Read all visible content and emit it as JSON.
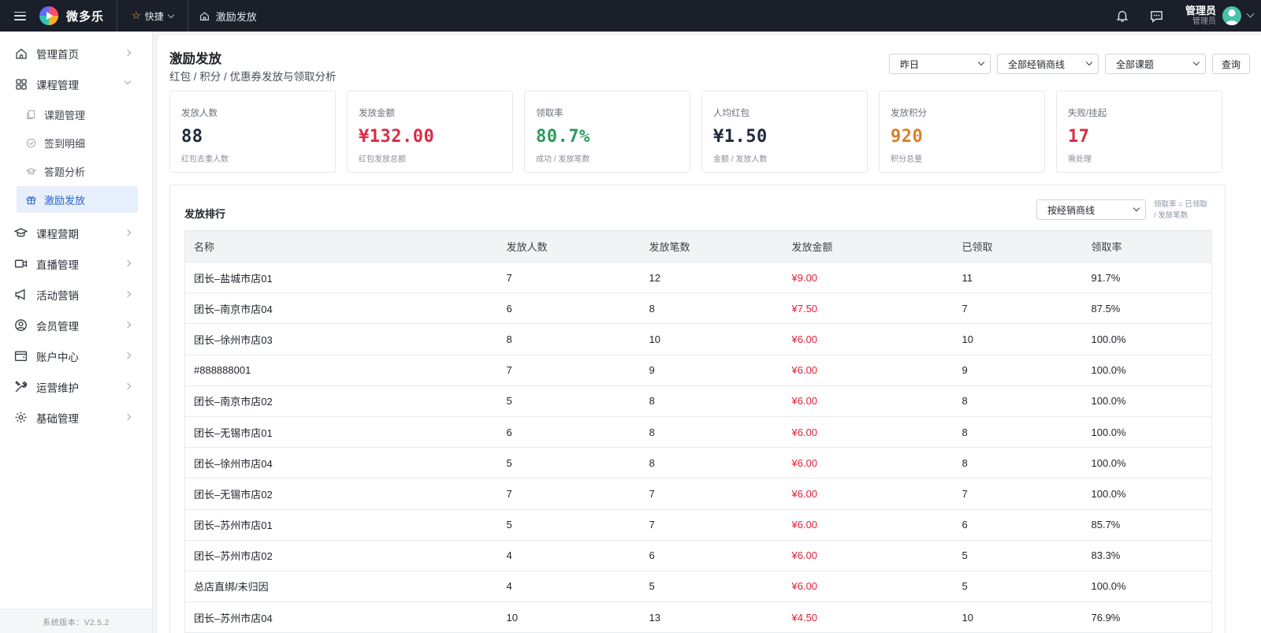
{
  "topbar": {
    "brand": "微多乐",
    "quick_label": "快捷",
    "breadcrumb": "激励发放",
    "user_name": "管理员",
    "user_role": "管理员"
  },
  "sidebar": {
    "items": [
      {
        "label": "管理首页",
        "icon": "home-icon"
      },
      {
        "label": "课程管理",
        "icon": "grid-icon",
        "expanded": true
      },
      {
        "label": "课程营期",
        "icon": "graduation-cap-icon"
      },
      {
        "label": "直播管理",
        "icon": "video-camera-icon"
      },
      {
        "label": "活动营销",
        "icon": "megaphone-icon"
      },
      {
        "label": "会员管理",
        "icon": "user-circle-icon"
      },
      {
        "label": "账户中心",
        "icon": "wallet-icon"
      },
      {
        "label": "运营维护",
        "icon": "tools-icon"
      },
      {
        "label": "基础管理",
        "icon": "gear-icon"
      }
    ],
    "subitems": [
      {
        "label": "课题管理",
        "icon": "document-copy-icon"
      },
      {
        "label": "签到明细",
        "icon": "check-circle-icon"
      },
      {
        "label": "答题分析",
        "icon": "cap-icon"
      },
      {
        "label": "激励发放",
        "icon": "gift-icon",
        "active": true
      }
    ],
    "version": "系统版本：V2.5.2"
  },
  "page": {
    "title": "激励发放",
    "subtitle": "红包 / 积分 / 优惠券发放与领取分析"
  },
  "filters": {
    "date": "昨日",
    "dealer": "全部经销商线",
    "topic": "全部课题",
    "query_label": "查询"
  },
  "stats": [
    {
      "label": "发放人数",
      "value": "88",
      "desc": "红包去重人数",
      "color": "#1f2a3c"
    },
    {
      "label": "发放金额",
      "value": "¥132.00",
      "desc": "红包发放总额",
      "color": "#d92d46"
    },
    {
      "label": "领取率",
      "value": "80.7%",
      "desc": "成功 / 发放笔数",
      "color": "#2f9a5c"
    },
    {
      "label": "人均红包",
      "value": "¥1.50",
      "desc": "金额 / 发放人数",
      "color": "#1f2a3c"
    },
    {
      "label": "发放积分",
      "value": "920",
      "desc": "积分总量",
      "color": "#d9802a"
    },
    {
      "label": "失败/挂起",
      "value": "17",
      "desc": "需处理",
      "color": "#d92d46"
    }
  ],
  "ranking": {
    "title": "发放排行",
    "group_by": "按经销商线",
    "note": "领取率 = 已领取 / 发放笔数",
    "columns": [
      "名称",
      "发放人数",
      "发放笔数",
      "发放金额",
      "已领取",
      "领取率"
    ],
    "rows": [
      [
        "团长–盐城市店01",
        "7",
        "12",
        "¥9.00",
        "11",
        "91.7%"
      ],
      [
        "团长–南京市店04",
        "6",
        "8",
        "¥7.50",
        "7",
        "87.5%"
      ],
      [
        "团长–徐州市店03",
        "8",
        "10",
        "¥6.00",
        "10",
        "100.0%"
      ],
      [
        "#888888001",
        "7",
        "9",
        "¥6.00",
        "9",
        "100.0%"
      ],
      [
        "团长–南京市店02",
        "5",
        "8",
        "¥6.00",
        "8",
        "100.0%"
      ],
      [
        "团长–无锡市店01",
        "6",
        "8",
        "¥6.00",
        "8",
        "100.0%"
      ],
      [
        "团长–徐州市店04",
        "5",
        "8",
        "¥6.00",
        "8",
        "100.0%"
      ],
      [
        "团长–无锡市店02",
        "7",
        "7",
        "¥6.00",
        "7",
        "100.0%"
      ],
      [
        "团长–苏州市店01",
        "5",
        "7",
        "¥6.00",
        "6",
        "85.7%"
      ],
      [
        "团长–苏州市店02",
        "4",
        "6",
        "¥6.00",
        "5",
        "83.3%"
      ],
      [
        "总店直绑/未归因",
        "4",
        "5",
        "¥6.00",
        "5",
        "100.0%"
      ],
      [
        "团长–苏州市店04",
        "10",
        "13",
        "¥4.50",
        "10",
        "76.9%"
      ]
    ]
  }
}
